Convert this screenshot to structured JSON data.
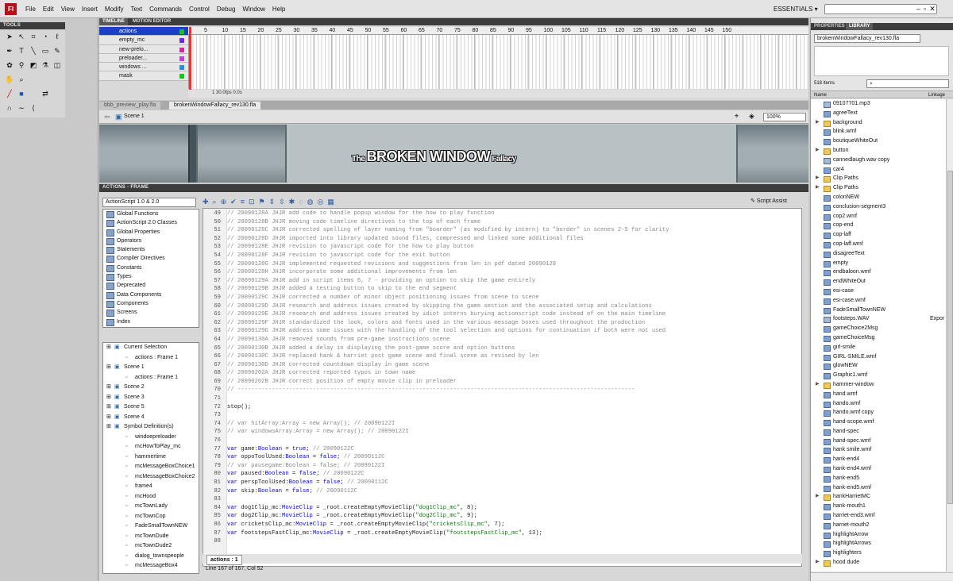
{
  "app": {
    "logo": "Fl"
  },
  "menu": [
    "File",
    "Edit",
    "View",
    "Insert",
    "Modify",
    "Text",
    "Commands",
    "Control",
    "Debug",
    "Window",
    "Help"
  ],
  "workspace": "ESSENTIALS ▾",
  "tools_title": "TOOLS",
  "tools_icons": [
    "arrow-icon",
    "subselect-icon",
    "free-transform-icon",
    "3d-rotation-icon",
    "lasso-icon",
    "",
    "pen-icon",
    "text-icon",
    "line-icon",
    "rect-icon",
    "pencil-icon",
    "brush-icon",
    "deco-icon",
    "bone-icon",
    "paint-bucket-icon",
    "eyedropper-icon",
    "eraser-icon",
    "",
    "hand-icon",
    "zoom-icon",
    "",
    "",
    "",
    "",
    "stroke-color-icon",
    "fill-color-icon",
    "",
    "swap-colors-icon",
    "",
    "",
    "snap-icon",
    "smooth-icon",
    "straighten-icon",
    "",
    "",
    ""
  ],
  "timeline": {
    "tabs": [
      "TIMELINE",
      "MOTION EDITOR"
    ],
    "layers": [
      "actions",
      "empty_mc",
      "new-prelo...",
      "preloader...",
      "windows ...",
      "mask"
    ],
    "ruler": [
      "5",
      "10",
      "15",
      "20",
      "25",
      "30",
      "35",
      "40",
      "45",
      "50",
      "55",
      "60",
      "65",
      "70",
      "75",
      "80",
      "85",
      "90",
      "95",
      "100",
      "105",
      "110",
      "115",
      "120",
      "125",
      "130",
      "135",
      "140",
      "145",
      "150"
    ],
    "footer": "1    30.0fps    0.0s"
  },
  "doc_tabs": [
    "bbb_preview_play.fla",
    "brokenWindowFallacy_rev130.fla"
  ],
  "scene": {
    "label": "Scene 1",
    "zoom": "100%"
  },
  "stage": {
    "title_a": "The ",
    "title_b": "BROKEN WINDOW",
    "title_c": " Fallacy"
  },
  "actions": {
    "panel_title": "ACTIONS - FRAME",
    "version": "ActionScript 1.0 & 2.0",
    "toolbox": [
      "Global Functions",
      "ActionScript 2.0 Classes",
      "Global Properties",
      "Operators",
      "Statements",
      "Compiler Directives",
      "Constants",
      "Types",
      "Deprecated",
      "Data Components",
      "Components",
      "Screens",
      "Index"
    ],
    "nav": [
      {
        "t": "Current Selection",
        "d": 0
      },
      {
        "t": "actions : Frame 1",
        "d": 1
      },
      {
        "t": "Scene 1",
        "d": 0
      },
      {
        "t": "actions : Frame 1",
        "d": 1
      },
      {
        "t": "Scene 2",
        "d": 0
      },
      {
        "t": "Scene 3",
        "d": 0
      },
      {
        "t": "Scene 5",
        "d": 0
      },
      {
        "t": "Scene 4",
        "d": 0
      },
      {
        "t": "Symbol Definition(s)",
        "d": 0
      },
      {
        "t": "windoepreloader",
        "d": 1
      },
      {
        "t": "mcHowToPlay_mc",
        "d": 1
      },
      {
        "t": "hammertime",
        "d": 1
      },
      {
        "t": "mcMessageBoxChoice1",
        "d": 1
      },
      {
        "t": "mcMessageBoxChoice2",
        "d": 1
      },
      {
        "t": "frame4",
        "d": 1
      },
      {
        "t": "mcHood",
        "d": 1
      },
      {
        "t": "mcTownLady",
        "d": 1
      },
      {
        "t": "mcTownCop",
        "d": 1
      },
      {
        "t": "FadeSmallTownNEW",
        "d": 1
      },
      {
        "t": "mcTownDude",
        "d": 1
      },
      {
        "t": "mcTownDude2",
        "d": 1
      },
      {
        "t": "dialog_townspeople",
        "d": 1
      },
      {
        "t": "mcMessageBox4",
        "d": 1
      }
    ],
    "script_assist": "Script Assist",
    "tab": "actions : 1",
    "status": "Line 167 of 167, Col 52",
    "code": [
      {
        "n": "49",
        "t": "// 20090128A JHJR add code to handle popup window for the how to play function",
        "c": 1
      },
      {
        "n": "50",
        "t": "// 20090128B JHJR moving code timeline directives to the top of each frame",
        "c": 1
      },
      {
        "n": "51",
        "t": "// 20090128C JHJR corrected spelling of layer naming from \"boarder\" (as modified by intern) to \"border\" in scenes 2-5 for clarity",
        "c": 1
      },
      {
        "n": "52",
        "t": "// 20090128D JHJR imported into library updated sound files, compressed and linked some additional files",
        "c": 1
      },
      {
        "n": "53",
        "t": "// 20090128E JHJR revision to javascript code for the how to play button",
        "c": 1
      },
      {
        "n": "54",
        "t": "// 20090128F JHJR revision to javascript code for the exit button",
        "c": 1
      },
      {
        "n": "55",
        "t": "// 20090128G JHJR implemented requested revisions and suggestions from len in pdf dated 20090128",
        "c": 1
      },
      {
        "n": "56",
        "t": "// 20090128H JHJR incorporate some additional improvements from len",
        "c": 1
      },
      {
        "n": "57",
        "t": "// 20090129A JHJR add in script items 6, 7 - providing an option to skip the game entirely",
        "c": 1
      },
      {
        "n": "58",
        "t": "// 20090129B JHJR added a testing button to skip to the end segment",
        "c": 1
      },
      {
        "n": "59",
        "t": "// 20090129C JHJR corrected a number of minor object positioning issues from scene to scene",
        "c": 1
      },
      {
        "n": "60",
        "t": "// 20090129D JHJR research and address issues created by skipping the game section and the associated setup and calculations",
        "c": 1
      },
      {
        "n": "61",
        "t": "// 20090129E JHJR research and address issues created by idiot interns burying actionscript code instead of on the main timeline",
        "c": 1
      },
      {
        "n": "62",
        "t": "// 20090129F JHJR standardized the look, colors and fonts used in the various message boxes used throughout the production",
        "c": 1
      },
      {
        "n": "63",
        "t": "// 20090129G JHJR address some issues with the handling of the tool selection and options for continuation if both were not used",
        "c": 1
      },
      {
        "n": "64",
        "t": "// 20090130A JHJR removed sounds from pre-game instructions scene",
        "c": 1
      },
      {
        "n": "65",
        "t": "// 20090130B JHJR added a delay in displaying the post-game score and option buttons",
        "c": 1
      },
      {
        "n": "66",
        "t": "// 20090130C JHJR replaced hank & harriet post game scene and final scene as revised by len",
        "c": 1
      },
      {
        "n": "67",
        "t": "// 20090130D JHJR corrected countdown display in game scene",
        "c": 1
      },
      {
        "n": "68",
        "t": "// 20090202A JHJR corrected reported typos in town name",
        "c": 1
      },
      {
        "n": "69",
        "t": "// 20090202B JHJR correct position of empty movie clip in preloader",
        "c": 1
      },
      {
        "n": "70",
        "t": "// --------------------------------------------------------------------------------------------------------------------",
        "c": 1
      },
      {
        "n": "71",
        "t": "",
        "c": 0
      },
      {
        "n": "72",
        "t": "stop();",
        "c": 0
      },
      {
        "n": "73",
        "t": "",
        "c": 0
      },
      {
        "n": "74",
        "t": "// var hitArray:Array = new Array(); // 20090122I",
        "c": 1
      },
      {
        "n": "75",
        "t": "// var windowsArray:Array = new Array(); // 20090122I",
        "c": 1
      },
      {
        "n": "76",
        "t": "",
        "c": 0
      },
      {
        "n": "77",
        "t": "var game:Boolean = true; // 20090122C",
        "c": 0
      },
      {
        "n": "78",
        "t": "var oppoToolUsed:Boolean = false; // 20090112C",
        "c": 0
      },
      {
        "n": "79",
        "t": "// var pausegame:Boolean = false; // 20090122I",
        "c": 1
      },
      {
        "n": "80",
        "t": "var paused:Boolean = false; // 20090122C",
        "c": 0
      },
      {
        "n": "81",
        "t": "var perspToolUsed:Boolean = false; // 20090112C",
        "c": 0
      },
      {
        "n": "82",
        "t": "var skip:Boolean = false; // 20090112C",
        "c": 0
      },
      {
        "n": "83",
        "t": "",
        "c": 0
      },
      {
        "n": "84",
        "t": "var dog1Clip_mc:MovieClip = _root.createEmptyMovieClip(\"dog1Clip_mc\", 8);",
        "c": 0
      },
      {
        "n": "85",
        "t": "var dog2Clip_mc:MovieClip = _root.createEmptyMovieClip(\"dog2Clip_mc\", 9);",
        "c": 0
      },
      {
        "n": "86",
        "t": "var cricketsClip_mc:MovieClip = _root.createEmptyMovieClip(\"cricketsClip_mc\", 7);",
        "c": 0
      },
      {
        "n": "87",
        "t": "var footstepsFastClip_mc:MovieClip = _root.createEmptyMovieClip(\"footstepsFastClip_mc\", 13);",
        "c": 0
      },
      {
        "n": "88",
        "t": "",
        "c": 0
      }
    ]
  },
  "right": {
    "tabs": [
      "PROPERTIES",
      "LIBRARY"
    ],
    "library_file": "brokenWindowFallacy_rev130.fla",
    "count": "518 items",
    "col_name": "Name",
    "col_linkage": "Linkage",
    "items": [
      {
        "t": "09107701.mp3",
        "k": "sound"
      },
      {
        "t": "agreeText",
        "k": "sym"
      },
      {
        "t": "background",
        "k": "folder"
      },
      {
        "t": "blink.wmf",
        "k": "sym"
      },
      {
        "t": "boutiqueWhiteOut",
        "k": "sym"
      },
      {
        "t": "button",
        "k": "folder"
      },
      {
        "t": "cannedlaugh.wav copy",
        "k": "sound"
      },
      {
        "t": "car4",
        "k": "sym"
      },
      {
        "t": "Clip Paths",
        "k": "folder"
      },
      {
        "t": "Clip Paths",
        "k": "folder"
      },
      {
        "t": "colonNEW",
        "k": "sym"
      },
      {
        "t": "conclusion-segment3",
        "k": "sym"
      },
      {
        "t": "cop2.wmf",
        "k": "sym"
      },
      {
        "t": "cop-end",
        "k": "sym"
      },
      {
        "t": "cop-laff",
        "k": "sym"
      },
      {
        "t": "cop-laff.wmf",
        "k": "sym"
      },
      {
        "t": "disagreeText",
        "k": "sym"
      },
      {
        "t": "empty",
        "k": "sym"
      },
      {
        "t": "endbaloon.wmf",
        "k": "sym"
      },
      {
        "t": "endWhiteOut",
        "k": "sym"
      },
      {
        "t": "esi-case",
        "k": "sym"
      },
      {
        "t": "esi-case.wmf",
        "k": "sym"
      },
      {
        "t": "FadeSmallTownNEW",
        "k": "sym"
      },
      {
        "t": "footsteps.WAV",
        "k": "sound",
        "ext": "Expor"
      },
      {
        "t": "gameChoice2Msg",
        "k": "sym"
      },
      {
        "t": "gameChoiceMsg",
        "k": "sym"
      },
      {
        "t": "girl-smile",
        "k": "sym"
      },
      {
        "t": "GIRL-SMILE.wmf",
        "k": "sym"
      },
      {
        "t": "glowNEW",
        "k": "sym"
      },
      {
        "t": "Graphic1.wmf",
        "k": "sym"
      },
      {
        "t": "hammer-window",
        "k": "folder"
      },
      {
        "t": "hand.wmf",
        "k": "sym"
      },
      {
        "t": "hando.wmf",
        "k": "sym"
      },
      {
        "t": "hando.wmf copy",
        "k": "sym"
      },
      {
        "t": "hand-scope.wmf",
        "k": "sym"
      },
      {
        "t": "hand-spec",
        "k": "sym"
      },
      {
        "t": "hand-spec.wmf",
        "k": "sym"
      },
      {
        "t": "hank smile.wmf",
        "k": "sym"
      },
      {
        "t": "hank-end4",
        "k": "sym"
      },
      {
        "t": "hank-end4.wmf",
        "k": "sym"
      },
      {
        "t": "hank-end5",
        "k": "sym"
      },
      {
        "t": "hank-end5.wmf",
        "k": "sym"
      },
      {
        "t": "hankHarrietMC",
        "k": "folder"
      },
      {
        "t": "hank-mouth1",
        "k": "sym"
      },
      {
        "t": "harriet-end3.wmf",
        "k": "sym"
      },
      {
        "t": "harriet-mouth2",
        "k": "sym"
      },
      {
        "t": "highlightArrow",
        "k": "sym"
      },
      {
        "t": "highlightArrows",
        "k": "sym"
      },
      {
        "t": "highlighters",
        "k": "sym"
      },
      {
        "t": "hood dude",
        "k": "folder"
      }
    ]
  }
}
